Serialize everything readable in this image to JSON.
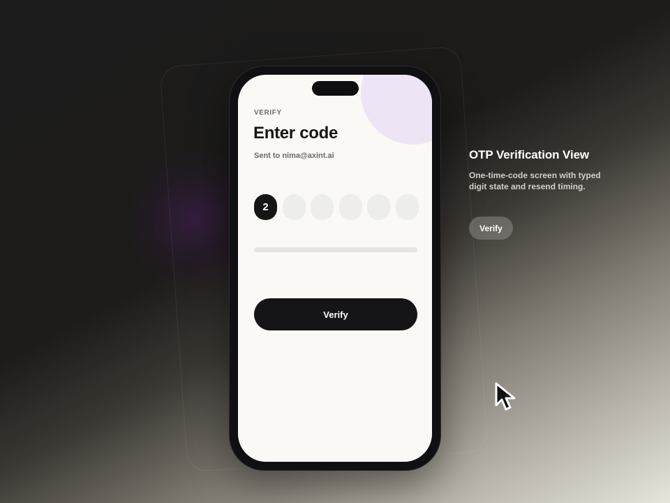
{
  "phone": {
    "eyebrow": "VERIFY",
    "title": "Enter code",
    "subtitle": "Sent to nima@axint.ai",
    "digits": [
      "2",
      "",
      "",
      "",
      "",
      ""
    ],
    "resend_progress": 0,
    "verify_label": "Verify"
  },
  "side_panel": {
    "title": "OTP Verification View",
    "description": "One-time-code screen with typed digit state and resend timing.",
    "button_label": "Verify"
  },
  "icons": {
    "cursor": "mouse-pointer-icon"
  },
  "colors": {
    "accent": "#151515",
    "screen_bg": "#faf9f6",
    "deco_circle": "#ede5f6",
    "digit_empty": "#ededea"
  }
}
